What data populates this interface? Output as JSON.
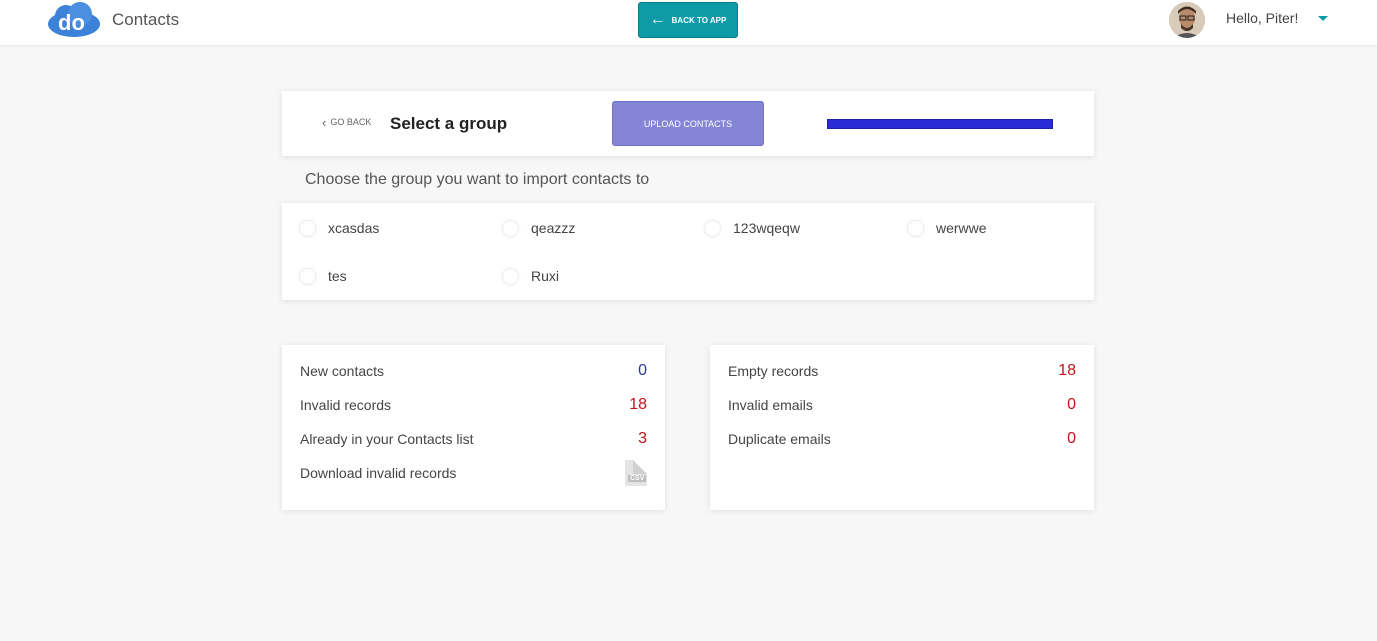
{
  "topbar": {
    "app_title": "Contacts",
    "logo_text": "do",
    "back_to_app_label": "BACK TO APP",
    "greeting": "Hello, Piter!"
  },
  "header": {
    "go_back_label": "GO BACK",
    "title": "Select a group",
    "upload_label": "UPLOAD CONTACTS",
    "progress_percent": 100
  },
  "groups": {
    "prompt": "Choose the group you want to import contacts to",
    "options": [
      "xcasdas",
      "qeazzz",
      "123wqeqw",
      "werwwe",
      "tes",
      "Ruxi"
    ]
  },
  "stats_left": {
    "rows": [
      {
        "label": "New contacts",
        "value": "0",
        "color": "#2b3a8f"
      },
      {
        "label": "Invalid records",
        "value": "18",
        "color": "#c0141c"
      },
      {
        "label": "Already in your Contacts list",
        "value": "3",
        "color": "#c0141c"
      },
      {
        "label": "Download invalid records",
        "icon": "csv-file-icon",
        "icon_text": "CSV"
      }
    ]
  },
  "stats_right": {
    "rows": [
      {
        "label": "Empty records",
        "value": "18",
        "color": "#c0141c"
      },
      {
        "label": "Invalid emails",
        "value": "0",
        "color": "#c0141c"
      },
      {
        "label": "Duplicate emails",
        "value": "0",
        "color": "#c0141c"
      }
    ]
  },
  "colors": {
    "accent": "#0e9aa7",
    "upload_button": "#8585d6",
    "progress": "#2a2ad6"
  }
}
